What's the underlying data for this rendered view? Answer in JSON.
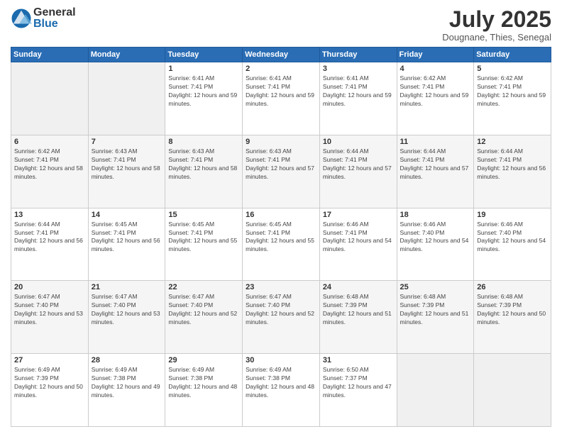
{
  "header": {
    "logo_general": "General",
    "logo_blue": "Blue",
    "month_year": "July 2025",
    "location": "Dougnane, Thies, Senegal"
  },
  "days_of_week": [
    "Sunday",
    "Monday",
    "Tuesday",
    "Wednesday",
    "Thursday",
    "Friday",
    "Saturday"
  ],
  "weeks": [
    [
      {
        "day": "",
        "sunrise": "",
        "sunset": "",
        "daylight": "",
        "empty": true
      },
      {
        "day": "",
        "sunrise": "",
        "sunset": "",
        "daylight": "",
        "empty": true
      },
      {
        "day": "1",
        "sunrise": "Sunrise: 6:41 AM",
        "sunset": "Sunset: 7:41 PM",
        "daylight": "Daylight: 12 hours and 59 minutes."
      },
      {
        "day": "2",
        "sunrise": "Sunrise: 6:41 AM",
        "sunset": "Sunset: 7:41 PM",
        "daylight": "Daylight: 12 hours and 59 minutes."
      },
      {
        "day": "3",
        "sunrise": "Sunrise: 6:41 AM",
        "sunset": "Sunset: 7:41 PM",
        "daylight": "Daylight: 12 hours and 59 minutes."
      },
      {
        "day": "4",
        "sunrise": "Sunrise: 6:42 AM",
        "sunset": "Sunset: 7:41 PM",
        "daylight": "Daylight: 12 hours and 59 minutes."
      },
      {
        "day": "5",
        "sunrise": "Sunrise: 6:42 AM",
        "sunset": "Sunset: 7:41 PM",
        "daylight": "Daylight: 12 hours and 59 minutes."
      }
    ],
    [
      {
        "day": "6",
        "sunrise": "Sunrise: 6:42 AM",
        "sunset": "Sunset: 7:41 PM",
        "daylight": "Daylight: 12 hours and 58 minutes."
      },
      {
        "day": "7",
        "sunrise": "Sunrise: 6:43 AM",
        "sunset": "Sunset: 7:41 PM",
        "daylight": "Daylight: 12 hours and 58 minutes."
      },
      {
        "day": "8",
        "sunrise": "Sunrise: 6:43 AM",
        "sunset": "Sunset: 7:41 PM",
        "daylight": "Daylight: 12 hours and 58 minutes."
      },
      {
        "day": "9",
        "sunrise": "Sunrise: 6:43 AM",
        "sunset": "Sunset: 7:41 PM",
        "daylight": "Daylight: 12 hours and 57 minutes."
      },
      {
        "day": "10",
        "sunrise": "Sunrise: 6:44 AM",
        "sunset": "Sunset: 7:41 PM",
        "daylight": "Daylight: 12 hours and 57 minutes."
      },
      {
        "day": "11",
        "sunrise": "Sunrise: 6:44 AM",
        "sunset": "Sunset: 7:41 PM",
        "daylight": "Daylight: 12 hours and 57 minutes."
      },
      {
        "day": "12",
        "sunrise": "Sunrise: 6:44 AM",
        "sunset": "Sunset: 7:41 PM",
        "daylight": "Daylight: 12 hours and 56 minutes."
      }
    ],
    [
      {
        "day": "13",
        "sunrise": "Sunrise: 6:44 AM",
        "sunset": "Sunset: 7:41 PM",
        "daylight": "Daylight: 12 hours and 56 minutes."
      },
      {
        "day": "14",
        "sunrise": "Sunrise: 6:45 AM",
        "sunset": "Sunset: 7:41 PM",
        "daylight": "Daylight: 12 hours and 56 minutes."
      },
      {
        "day": "15",
        "sunrise": "Sunrise: 6:45 AM",
        "sunset": "Sunset: 7:41 PM",
        "daylight": "Daylight: 12 hours and 55 minutes."
      },
      {
        "day": "16",
        "sunrise": "Sunrise: 6:45 AM",
        "sunset": "Sunset: 7:41 PM",
        "daylight": "Daylight: 12 hours and 55 minutes."
      },
      {
        "day": "17",
        "sunrise": "Sunrise: 6:46 AM",
        "sunset": "Sunset: 7:41 PM",
        "daylight": "Daylight: 12 hours and 54 minutes."
      },
      {
        "day": "18",
        "sunrise": "Sunrise: 6:46 AM",
        "sunset": "Sunset: 7:40 PM",
        "daylight": "Daylight: 12 hours and 54 minutes."
      },
      {
        "day": "19",
        "sunrise": "Sunrise: 6:46 AM",
        "sunset": "Sunset: 7:40 PM",
        "daylight": "Daylight: 12 hours and 54 minutes."
      }
    ],
    [
      {
        "day": "20",
        "sunrise": "Sunrise: 6:47 AM",
        "sunset": "Sunset: 7:40 PM",
        "daylight": "Daylight: 12 hours and 53 minutes."
      },
      {
        "day": "21",
        "sunrise": "Sunrise: 6:47 AM",
        "sunset": "Sunset: 7:40 PM",
        "daylight": "Daylight: 12 hours and 53 minutes."
      },
      {
        "day": "22",
        "sunrise": "Sunrise: 6:47 AM",
        "sunset": "Sunset: 7:40 PM",
        "daylight": "Daylight: 12 hours and 52 minutes."
      },
      {
        "day": "23",
        "sunrise": "Sunrise: 6:47 AM",
        "sunset": "Sunset: 7:40 PM",
        "daylight": "Daylight: 12 hours and 52 minutes."
      },
      {
        "day": "24",
        "sunrise": "Sunrise: 6:48 AM",
        "sunset": "Sunset: 7:39 PM",
        "daylight": "Daylight: 12 hours and 51 minutes."
      },
      {
        "day": "25",
        "sunrise": "Sunrise: 6:48 AM",
        "sunset": "Sunset: 7:39 PM",
        "daylight": "Daylight: 12 hours and 51 minutes."
      },
      {
        "day": "26",
        "sunrise": "Sunrise: 6:48 AM",
        "sunset": "Sunset: 7:39 PM",
        "daylight": "Daylight: 12 hours and 50 minutes."
      }
    ],
    [
      {
        "day": "27",
        "sunrise": "Sunrise: 6:49 AM",
        "sunset": "Sunset: 7:39 PM",
        "daylight": "Daylight: 12 hours and 50 minutes."
      },
      {
        "day": "28",
        "sunrise": "Sunrise: 6:49 AM",
        "sunset": "Sunset: 7:38 PM",
        "daylight": "Daylight: 12 hours and 49 minutes."
      },
      {
        "day": "29",
        "sunrise": "Sunrise: 6:49 AM",
        "sunset": "Sunset: 7:38 PM",
        "daylight": "Daylight: 12 hours and 48 minutes."
      },
      {
        "day": "30",
        "sunrise": "Sunrise: 6:49 AM",
        "sunset": "Sunset: 7:38 PM",
        "daylight": "Daylight: 12 hours and 48 minutes."
      },
      {
        "day": "31",
        "sunrise": "Sunrise: 6:50 AM",
        "sunset": "Sunset: 7:37 PM",
        "daylight": "Daylight: 12 hours and 47 minutes."
      },
      {
        "day": "",
        "sunrise": "",
        "sunset": "",
        "daylight": "",
        "empty": true
      },
      {
        "day": "",
        "sunrise": "",
        "sunset": "",
        "daylight": "",
        "empty": true
      }
    ]
  ]
}
